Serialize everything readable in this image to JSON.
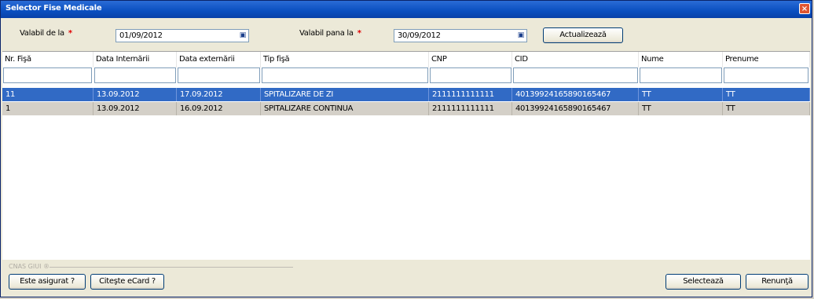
{
  "window": {
    "title": "Selector Fise Medicale",
    "close_glyph": "×"
  },
  "filters": {
    "from_label": "Valabil de la",
    "from_value": "01/09/2012",
    "to_label": "Valabil pana la",
    "to_value": "30/09/2012",
    "required_mark": "*",
    "refresh_label": "Actualizează"
  },
  "grid": {
    "columns": [
      "Nr. Fişă",
      "Data Internării",
      "Data externării",
      "Tip fişă",
      "CNP",
      "CID",
      "Nume",
      "Prenume"
    ],
    "rows": [
      [
        "11",
        "13.09.2012",
        "17.09.2012",
        "SPITALIZARE DE ZI",
        "2111111111111",
        "40139924165890165467",
        "TT",
        "TT"
      ],
      [
        "1",
        "13.09.2012",
        "16.09.2012",
        "SPITALIZARE CONTINUA",
        "2111111111111",
        "40139924165890165467",
        "TT",
        "TT"
      ]
    ]
  },
  "footer": {
    "group_label": "CNAS GIUI ®",
    "check_insured_label": "Este asigurat ?",
    "read_ecard_label": "Citeşte eCard ?",
    "select_label": "Selectează",
    "cancel_label": "Renunţă"
  },
  "icons": {
    "calendar": "calendar-icon"
  }
}
